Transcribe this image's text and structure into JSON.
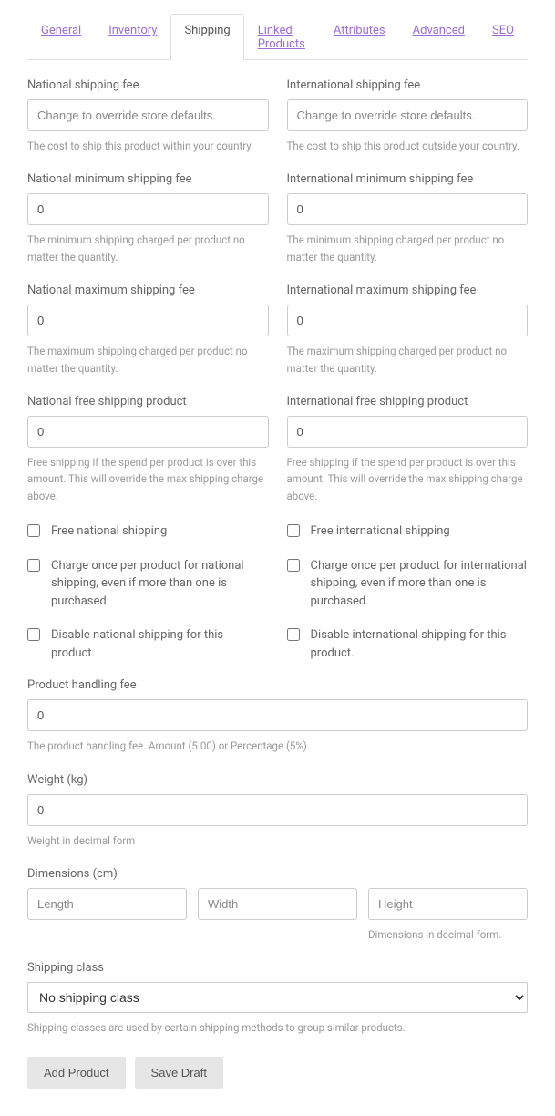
{
  "tabs": {
    "general": "General",
    "inventory": "Inventory",
    "shipping": "Shipping",
    "linked_products": "Linked Products",
    "attributes": "Attributes",
    "advanced": "Advanced",
    "seo": "SEO"
  },
  "national": {
    "fee_label": "National shipping fee",
    "fee_placeholder": "Change to override store defaults.",
    "fee_help": "The cost to ship this product within your country.",
    "min_label": "National minimum shipping fee",
    "min_value": "0",
    "min_help": "The minimum shipping charged per product no matter the quantity.",
    "max_label": "National maximum shipping fee",
    "max_value": "0",
    "max_help": "The maximum shipping charged per product no matter the quantity.",
    "free_label": "National free shipping product",
    "free_value": "0",
    "free_help": "Free shipping if the spend per product is over this amount. This will override the max shipping charge above.",
    "cb_free": "Free national shipping",
    "cb_once": "Charge once per product for national shipping, even if more than one is purchased.",
    "cb_disable": "Disable national shipping for this product."
  },
  "international": {
    "fee_label": "International shipping fee",
    "fee_placeholder": "Change to override store defaults.",
    "fee_help": "The cost to ship this product outside your country.",
    "min_label": "International minimum shipping fee",
    "min_value": "0",
    "min_help": "The minimum shipping charged per product no matter the quantity.",
    "max_label": "International maximum shipping fee",
    "max_value": "0",
    "max_help": "The maximum shipping charged per product no matter the quantity.",
    "free_label": "International free shipping product",
    "free_value": "0",
    "free_help": "Free shipping if the spend per product is over this amount. This will override the max shipping charge above.",
    "cb_free": "Free international shipping",
    "cb_once": "Charge once per product for international shipping, even if more than one is purchased.",
    "cb_disable": "Disable international shipping for this product."
  },
  "handling": {
    "label": "Product handling fee",
    "value": "0",
    "help": "The product handling fee. Amount (5.00) or Percentage (5%)."
  },
  "weight": {
    "label": "Weight (kg)",
    "value": "0",
    "help": "Weight in decimal form"
  },
  "dimensions": {
    "label": "Dimensions (cm)",
    "length_placeholder": "Length",
    "width_placeholder": "Width",
    "height_placeholder": "Height",
    "help": "Dimensions in decimal form."
  },
  "shipping_class": {
    "label": "Shipping class",
    "selected": "No shipping class",
    "help": "Shipping classes are used by certain shipping methods to group similar products."
  },
  "buttons": {
    "add": "Add Product",
    "save": "Save Draft"
  }
}
